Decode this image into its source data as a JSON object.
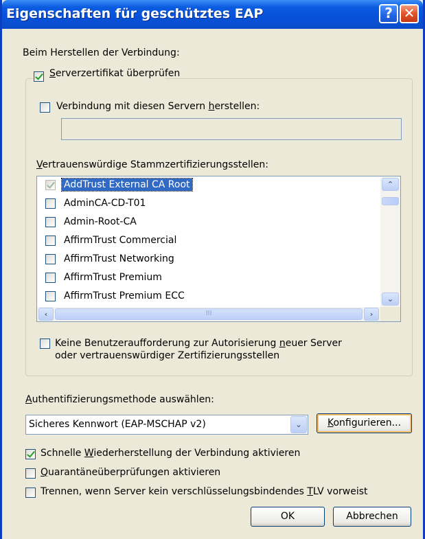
{
  "window": {
    "title": "Eigenschaften für geschütztes EAP",
    "help_glyph": "?",
    "close_glyph": "✕"
  },
  "connection": {
    "heading": "Beim Herstellen der Verbindung:",
    "verify_cert": {
      "label_u": "S",
      "label_rest": "erverzertifikat überprüfen",
      "checked": true
    },
    "connect_servers": {
      "label_a": "Verbindung mit diesen Servern ",
      "label_u": "h",
      "label_b": "erstellen:",
      "checked": false,
      "value": ""
    },
    "trusted_heading_u": "V",
    "trusted_heading_rest": "ertrauenswürdige Stammzertifizierungsstellen:",
    "trusted_roots": [
      {
        "label": "AddTrust External CA Root",
        "checked": true,
        "selected": true
      },
      {
        "label": "AdminCA-CD-T01",
        "checked": false,
        "selected": false
      },
      {
        "label": "Admin-Root-CA",
        "checked": false,
        "selected": false
      },
      {
        "label": "AffirmTrust Commercial",
        "checked": false,
        "selected": false
      },
      {
        "label": "AffirmTrust Networking",
        "checked": false,
        "selected": false
      },
      {
        "label": "AffirmTrust Premium",
        "checked": false,
        "selected": false
      },
      {
        "label": "AffirmTrust Premium ECC",
        "checked": false,
        "selected": false
      }
    ],
    "hscroll_grip": "III",
    "no_prompt": {
      "line1_a": "Keine Benutzeraufforderung zur Autorisierung ",
      "line1_u": "n",
      "line1_b": "euer Server",
      "line2": "oder vertrauenswürdiger Zertifizierungsstellen",
      "checked": false
    }
  },
  "auth": {
    "heading_u": "A",
    "heading_rest": "uthentifizierungsmethode auswählen:",
    "method": "Sicheres Kennwort (EAP-MSCHAP v2)",
    "configure_u": "K",
    "configure_rest": "onfigurieren..."
  },
  "options": {
    "fast_reconnect": {
      "label_a": "Schnelle ",
      "label_u": "W",
      "label_b": "iederherstellung der Verbindung aktivieren",
      "checked": true
    },
    "quarantine": {
      "label_u": "Q",
      "label_rest": "uarantäneüberprüfungen aktivieren",
      "checked": false
    },
    "disconnect": {
      "label_a": "Trennen, wenn Server kein verschlüsselungsbindendes ",
      "label_u": "T",
      "label_b": "LV vorweist",
      "checked": false
    }
  },
  "buttons": {
    "ok": "OK",
    "cancel": "Abbrechen"
  }
}
